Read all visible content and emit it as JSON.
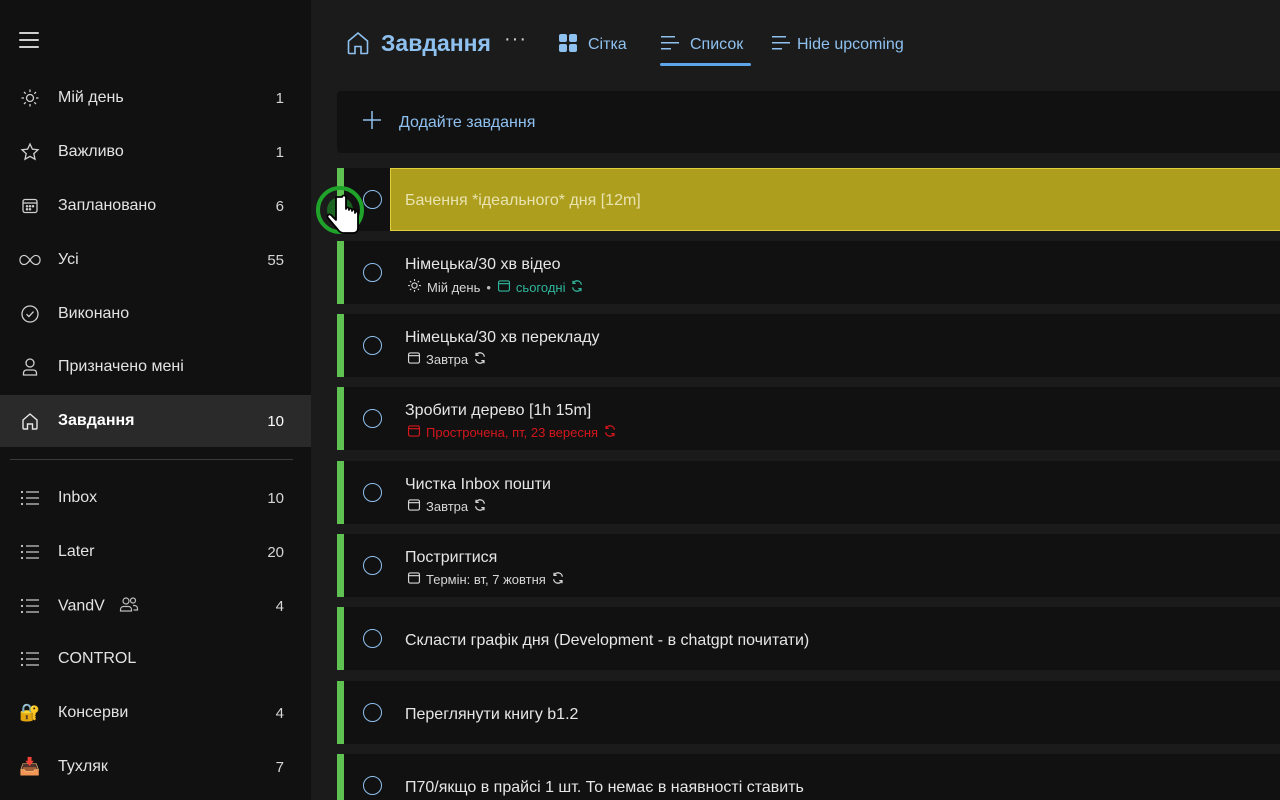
{
  "sidebar": {
    "menu_icon": "hamburger-icon",
    "smart_lists": [
      {
        "label": "Мій день",
        "count": "1",
        "icon": "sun-icon"
      },
      {
        "label": "Важливо",
        "count": "1",
        "icon": "star-icon"
      },
      {
        "label": "Заплановано",
        "count": "6",
        "icon": "calendar-icon"
      },
      {
        "label": "Усі",
        "count": "55",
        "icon": "infinity-icon"
      },
      {
        "label": "Виконано",
        "count": "",
        "icon": "check-circle-icon"
      },
      {
        "label": "Призначено мені",
        "count": "",
        "icon": "person-icon"
      },
      {
        "label": "Завдання",
        "count": "10",
        "icon": "home-icon",
        "active": true
      }
    ],
    "user_lists": [
      {
        "label": "Inbox",
        "count": "10",
        "icon": "list-icon"
      },
      {
        "label": "Later",
        "count": "20",
        "icon": "list-icon"
      },
      {
        "label": "VandV",
        "count": "4",
        "icon": "list-icon",
        "shared": true
      },
      {
        "label": "CONTROL",
        "count": "",
        "icon": "list-icon"
      },
      {
        "label": "Консерви",
        "count": "4",
        "icon": "lock-emoji-icon",
        "emoji": "🔐"
      },
      {
        "label": "Тухляк",
        "count": "7",
        "icon": "inbox-tray-emoji-icon",
        "emoji": "📥"
      }
    ]
  },
  "header": {
    "title": "Завдання",
    "more": "···",
    "views": [
      {
        "label": "Сітка",
        "icon": "grid-icon"
      },
      {
        "label": "Список",
        "icon": "list-view-icon",
        "selected": true
      },
      {
        "label": "Hide upcoming",
        "icon": "list-view-icon"
      }
    ]
  },
  "add_task": {
    "label": "Додайте завдання"
  },
  "tasks": [
    {
      "title": "Бачення *ідеального* дня [12m]",
      "selected": true
    },
    {
      "title": "Німецька/30 хв відео",
      "my_day": "Мій день",
      "due": "сьогодні",
      "due_style": "today",
      "repeat": true
    },
    {
      "title": "Німецька/30 хв перекладу",
      "due": "Завтра",
      "due_style": "normal",
      "repeat": true
    },
    {
      "title": "Зробити дерево [1h 15m]",
      "due": "Прострочена, пт, 23 вересня",
      "due_style": "overdue",
      "repeat": true
    },
    {
      "title": "Чистка Inbox пошти",
      "due": "Завтра",
      "due_style": "normal",
      "repeat": true
    },
    {
      "title": "Постригтися",
      "due": "Термін: вт, 7 жовтня",
      "due_style": "normal",
      "repeat": true
    },
    {
      "title": "Скласти графік дня (Development - в chatgpt почитати)"
    },
    {
      "title": "Переглянути книгу b1.2"
    },
    {
      "title": "П70/якщо в прайсі 1 шт. То немає в наявності ставить"
    }
  ],
  "colors": {
    "accent": "#8fc1f0",
    "list_bar": "#5fc152",
    "selected_task": "#ad9e1d",
    "today": "#2fb59b",
    "overdue": "#d4161c"
  }
}
